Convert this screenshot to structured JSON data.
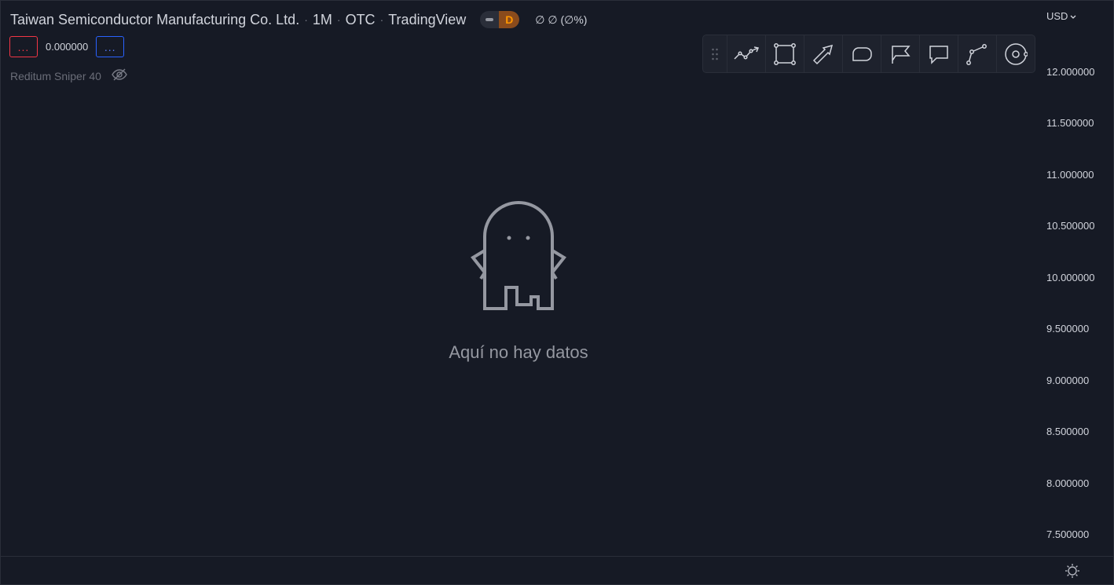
{
  "legend": {
    "symbol": "Taiwan Semiconductor Manufacturing Co. Ltd.",
    "interval": "1M",
    "exchange": "OTC",
    "source": "TradingView",
    "mode_badge": "D",
    "values": "∅  ∅ (∅%)"
  },
  "study": {
    "left_button": "...",
    "value": "0.000000",
    "right_button": "..."
  },
  "indicator": {
    "name": "Reditum Sniper 40",
    "visibility_icon": "eye-off-icon"
  },
  "toolbar": {
    "grip_icon": "drag-handle-icon",
    "tools": [
      "trend-line-icon",
      "rectangle-icon",
      "arrow-icon",
      "callout-icon",
      "flag-icon",
      "comment-icon",
      "path-icon",
      "cursor-circle-icon"
    ]
  },
  "empty_state": {
    "message": "Aquí no hay datos",
    "icon": "ghost-icon"
  },
  "price_scale": {
    "currency": "USD",
    "ticks": [
      "12.000000",
      "11.500000",
      "11.000000",
      "10.500000",
      "10.000000",
      "9.500000",
      "9.000000",
      "8.500000",
      "8.000000",
      "7.500000"
    ]
  },
  "colors": {
    "background": "#161a25",
    "text": "#d1d4dc",
    "muted": "#787b86",
    "red": "#f23645",
    "blue": "#2962ff",
    "orange": "#ff9800"
  }
}
